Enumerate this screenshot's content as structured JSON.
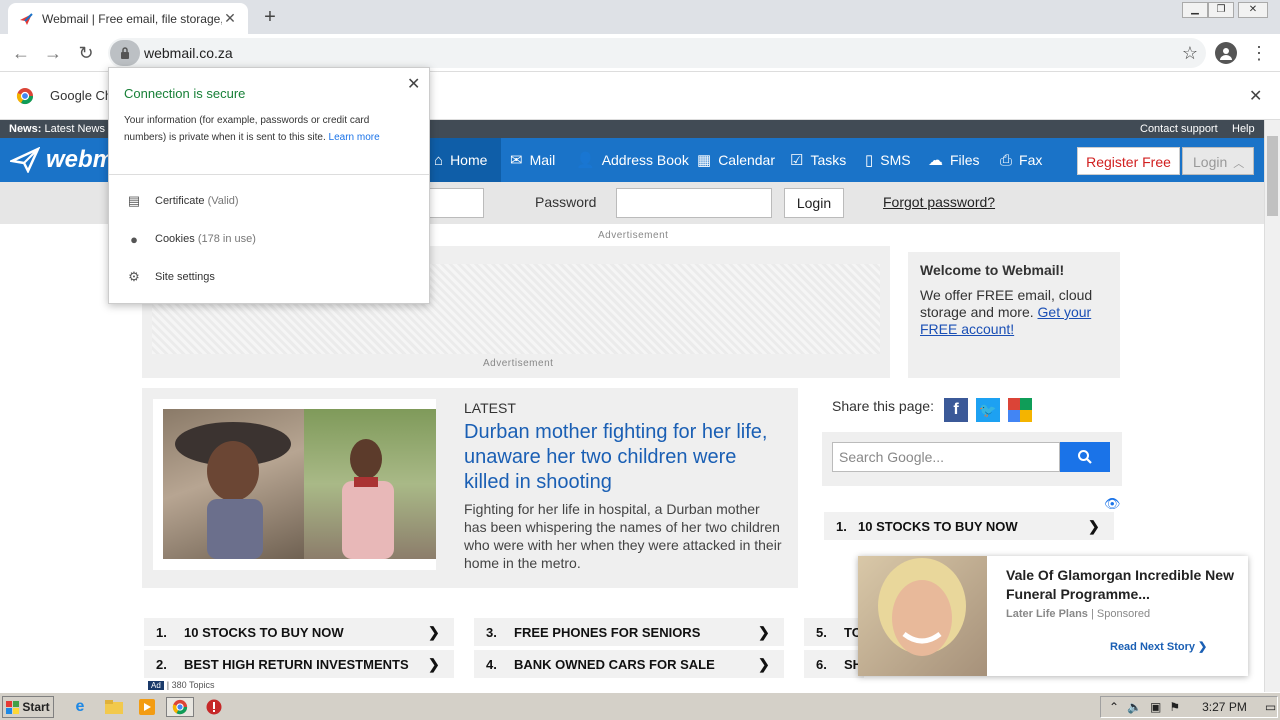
{
  "browser": {
    "tab_title": "Webmail | Free email, file storage, s",
    "url": "webmail.co.za",
    "infobar_text": "Google Ch"
  },
  "popup": {
    "title": "Connection is secure",
    "body": "Your information (for example, passwords or credit card numbers) is private when it is sent to this site.",
    "learn_more": "Learn more",
    "items": [
      {
        "label": "Certificate",
        "detail": "(Valid)",
        "icon": "certificate-icon"
      },
      {
        "label": "Cookies",
        "detail": "(178 in use)",
        "icon": "cookie-icon"
      },
      {
        "label": "Site settings",
        "detail": "",
        "icon": "gear-icon"
      }
    ]
  },
  "site": {
    "news_label": "News:",
    "news_text": "Latest News",
    "contact_support": "Contact support",
    "help": "Help",
    "logo": "webm",
    "nav": [
      "Home",
      "Mail",
      "Address Book",
      "Calendar",
      "Tasks",
      "SMS",
      "Files",
      "Fax"
    ],
    "register": "Register Free",
    "login_nav": "Login",
    "password_label": "Password",
    "login_button": "Login",
    "forgot": "Forgot password?",
    "advert_label": "Advertisement",
    "welcome_title": "Welcome to Webmail!",
    "welcome_text": "We offer FREE email, cloud storage and more.",
    "welcome_link": "Get your FREE account!",
    "latest_label": "LATEST",
    "headline": "Durban mother fighting for her life, unaware her two children were killed in shooting",
    "summary": "Fighting for her life in hospital, a Durban mother has been whispering the names of her two children who were with her when they were attacked in their home in the metro.",
    "share_label": "Share this page:",
    "search_placeholder": "Search Google...",
    "side_list_item": {
      "num": "1.",
      "text": "10 STOCKS TO BUY NOW"
    },
    "list": [
      {
        "num": "1.",
        "text": "10 STOCKS TO BUY NOW"
      },
      {
        "num": "2.",
        "text": "BEST HIGH RETURN INVESTMENTS"
      },
      {
        "num": "3.",
        "text": "FREE PHONES FOR SENIORS"
      },
      {
        "num": "4.",
        "text": "BANK OWNED CARS FOR SALE"
      },
      {
        "num": "5.",
        "text": "TO"
      },
      {
        "num": "6.",
        "text": "SH"
      }
    ],
    "ad_badge": "Ad",
    "topics": "| 380 Topics"
  },
  "ad_popup": {
    "title": "Vale Of Glamorgan Incredible New Funeral Programme...",
    "source": "Later Life Plans",
    "sponsored": "Sponsored",
    "cta": "Read Next Story"
  },
  "taskbar": {
    "start": "Start",
    "clock": "3:27 PM"
  },
  "colors": {
    "nav_blue": "#1a73c8",
    "secure_green": "#188038",
    "link_blue": "#1a4fb5",
    "register_red": "#d11f1f"
  }
}
